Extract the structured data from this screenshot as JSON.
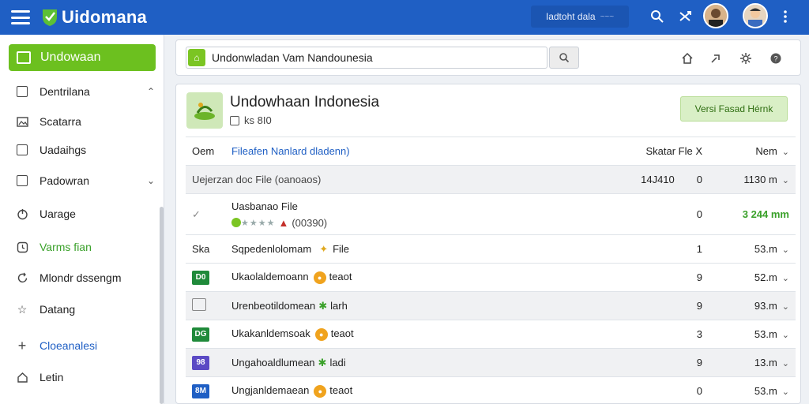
{
  "topbar": {
    "brand": "Uidomana",
    "search_text": "Iadtoht dala",
    "search_dots": "~~~",
    "icons": [
      "search-people-icon",
      "shuffle-icon",
      "more-vertical-icon"
    ]
  },
  "sidebar": {
    "active_label": "Undowaan",
    "items": [
      {
        "label": "Dentrilana",
        "icon": "checkbox-icon"
      },
      {
        "label": "Scatarra",
        "icon": "image-icon"
      },
      {
        "label": "Uadaihgs",
        "icon": "checkbox-icon"
      },
      {
        "label": "Padowran",
        "icon": "checkbox-icon"
      },
      {
        "label": "Uarage",
        "icon": "power-icon"
      },
      {
        "label": "Varms fian",
        "icon": "clock-icon"
      },
      {
        "label": "Mlondr dssengm",
        "icon": "refresh-icon"
      },
      {
        "label": "Datang",
        "icon": "star-icon"
      },
      {
        "label": "Cloeanalesi",
        "icon": "plus-icon"
      },
      {
        "label": "Letin",
        "icon": "home-icon"
      }
    ]
  },
  "searchbar": {
    "value": "Undonwladan Vam Nandounesia",
    "icons": [
      "home-icon",
      "share-icon",
      "settings-icon",
      "help-icon"
    ]
  },
  "app": {
    "title": "Undowhaan Indonesia",
    "subtitle": "ks 8I0",
    "action_button": "Versi Fasad Hérnk"
  },
  "table": {
    "headers": {
      "col1": "Oem",
      "file": "Fileafen Nanlard dladenn)",
      "scatar": "Skatar Fle X",
      "nem": "Nem"
    },
    "rows": [
      {
        "name": "Uejerzan doc File (oanoaos)",
        "num": "0",
        "code": "14J410",
        "size": "1130 m"
      },
      {
        "name": "Uasbanao File",
        "sub": "(00390)",
        "num": "0",
        "size": "3 244 mm"
      },
      {
        "tag": "Ska",
        "name": "Sqpedenlolomam",
        "suffix": "File",
        "num": "1",
        "size": "53.m"
      },
      {
        "tag": "D0",
        "tag_color": "#1f8a3a",
        "name": "Ukaolaldemoann",
        "suffix": "teaot",
        "num": "9",
        "size": "52.m"
      },
      {
        "name": "Urenbeotildomean",
        "suffix": "larh",
        "num": "9",
        "size": "93.m"
      },
      {
        "tag": "DG",
        "tag_color": "#1f8a3a",
        "name": "Ukakanldemsoak",
        "suffix": "teaot",
        "num": "3",
        "size": "53.m"
      },
      {
        "tag": "98",
        "tag_color": "#5b4ac4",
        "name": "Ungahoaldlumean",
        "suffix": "ladi",
        "num": "9",
        "size": "13.m"
      },
      {
        "tag": "8M",
        "tag_color": "#1f5fc4",
        "name": "Ungjanldemaean",
        "suffix": "teaot",
        "num": "0",
        "size": "53.m"
      }
    ]
  }
}
